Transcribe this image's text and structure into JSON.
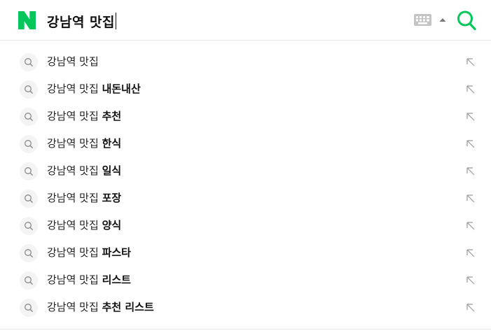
{
  "brand": {
    "logo_letter": "N",
    "accent_color": "#03c75a"
  },
  "search": {
    "query": "강남역 맛집"
  },
  "icons": {
    "logo": "naver-n-logo-icon",
    "keyboard": "keyboard-icon",
    "expand": "caret-up-icon",
    "search": "search-magnifier-icon",
    "suggestion": "search-icon",
    "insert": "arrow-up-left-icon"
  },
  "suggestions": [
    {
      "prefix": "강남역 맛집",
      "suffix": ""
    },
    {
      "prefix": "강남역 맛집",
      "suffix": "내돈내산"
    },
    {
      "prefix": "강남역 맛집",
      "suffix": "추천"
    },
    {
      "prefix": "강남역 맛집",
      "suffix": "한식"
    },
    {
      "prefix": "강남역 맛집",
      "suffix": "일식"
    },
    {
      "prefix": "강남역 맛집",
      "suffix": "포장"
    },
    {
      "prefix": "강남역 맛집",
      "suffix": "양식"
    },
    {
      "prefix": "강남역 맛집",
      "suffix": "파스타"
    },
    {
      "prefix": "강남역 맛집",
      "suffix": "리스트"
    },
    {
      "prefix": "강남역 맛집",
      "suffix": "추천 리스트"
    }
  ]
}
